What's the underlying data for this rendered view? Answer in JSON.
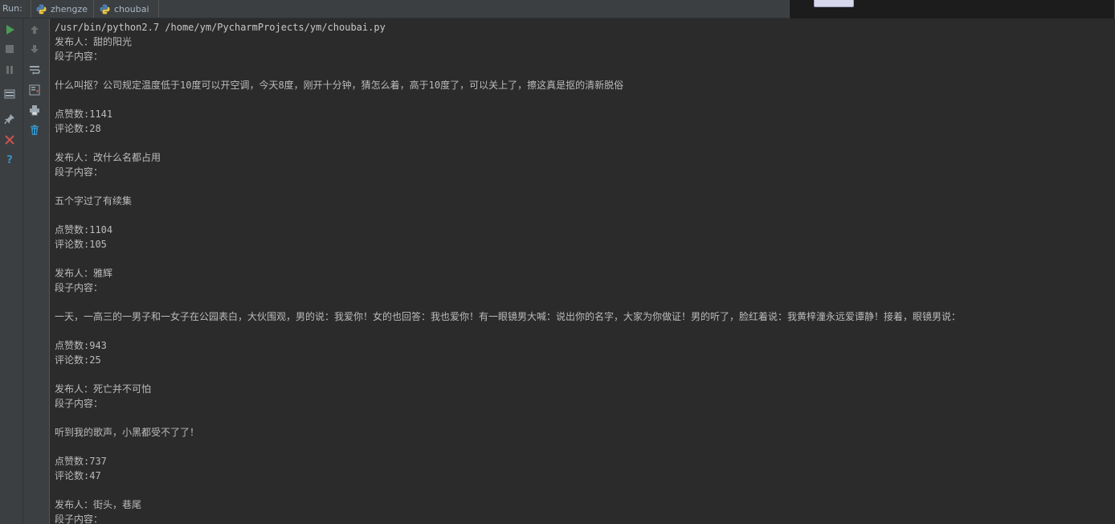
{
  "run_bar": {
    "label": "Run:",
    "tabs": [
      {
        "label": "zhengze",
        "icon": "python-icon"
      },
      {
        "label": "choubai",
        "icon": "python-icon"
      }
    ]
  },
  "toolbar_left": {
    "buttons": [
      "rerun-icon",
      "stop-icon",
      "pause-icon",
      "layout-icon",
      "pin-icon",
      "close-icon",
      "help-icon"
    ]
  },
  "toolbar_right": {
    "buttons": [
      "up-arrow-icon",
      "down-arrow-icon",
      "soft-wrap-icon",
      "scroll-to-end-icon",
      "print-icon",
      "clear-all-icon"
    ]
  },
  "colors": {
    "background": "#2b2b2b",
    "panel": "#3c3f41",
    "text": "#bbbbbb",
    "run_green": "#499c54",
    "close_red": "#c75450",
    "help_blue": "#3592c4"
  },
  "console": {
    "lines": [
      "/usr/bin/python2.7 /home/ym/PycharmProjects/ym/choubai.py",
      "发布人：甜的阳光",
      "段子内容：",
      "",
      "什么叫抠？公司规定温度低于10度可以开空调，今天8度，刚开十分钟，猜怎么着，高于10度了，可以关上了，擦这真是抠的清新脱俗",
      "",
      "点赞数:1141",
      "评论数:28",
      "",
      "发布人：改什么名都占用",
      "段子内容：",
      "",
      "五个字过了有续集",
      "",
      "点赞数:1104",
      "评论数:105",
      "",
      "发布人：雅辉",
      "段子内容：",
      "",
      "一天，一高三的一男子和一女子在公园表白，大伙围观，男的说：我爱你！女的也回答：我也爱你！有一眼镜男大喊：说出你的名字，大家为你做证！男的听了，脸红着说：我黄梓潼永远爱谭静！接着，眼镜男说：",
      "",
      "点赞数:943",
      "评论数:25",
      "",
      "发布人：死亡并不可怕",
      "段子内容：",
      "",
      "听到我的歌声，小黑都受不了了！",
      "",
      "点赞数:737",
      "评论数:47",
      "",
      "发布人：街头，巷尾",
      "段子内容："
    ]
  }
}
